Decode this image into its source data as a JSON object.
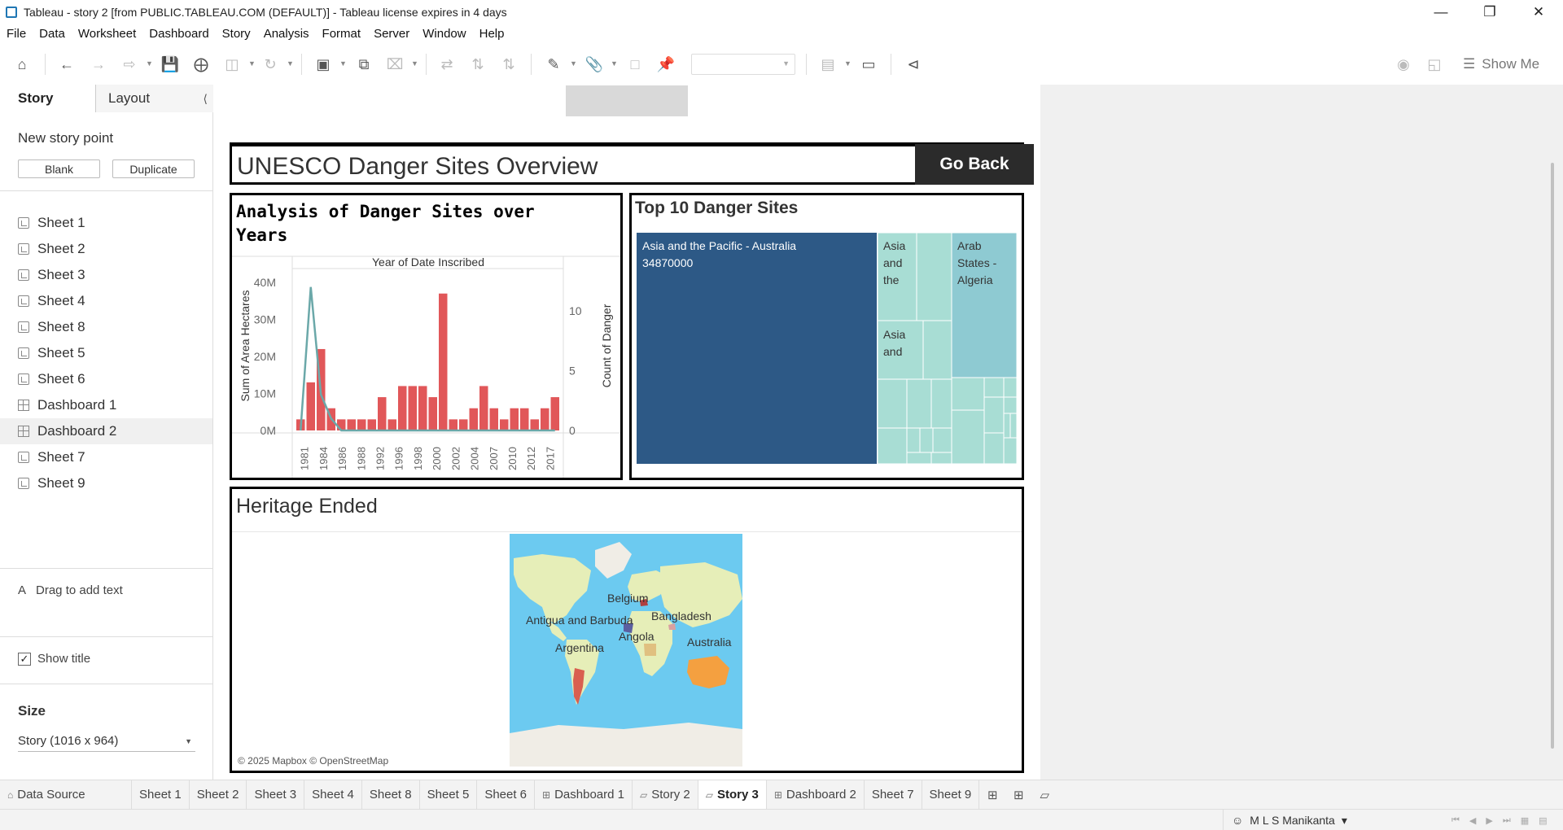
{
  "window": {
    "title": "Tableau - story 2 [from PUBLIC.TABLEAU.COM (DEFAULT)] - Tableau license expires in 4 days",
    "minimize_icon": "minimize-icon",
    "restore_icon": "restore-icon",
    "close_icon": "close-icon"
  },
  "menu": [
    "File",
    "Data",
    "Worksheet",
    "Dashboard",
    "Story",
    "Analysis",
    "Format",
    "Server",
    "Window",
    "Help"
  ],
  "toolbar": {
    "show_me": "Show Me"
  },
  "left_panel": {
    "tabs": {
      "story": "Story",
      "layout": "Layout"
    },
    "new_story_point": "New story point",
    "blank": "Blank",
    "duplicate": "Duplicate",
    "sheets": [
      {
        "label": "Sheet 1",
        "kind": "sheet"
      },
      {
        "label": "Sheet 2",
        "kind": "sheet"
      },
      {
        "label": "Sheet 3",
        "kind": "sheet"
      },
      {
        "label": "Sheet 4",
        "kind": "sheet"
      },
      {
        "label": "Sheet 8",
        "kind": "sheet"
      },
      {
        "label": "Sheet 5",
        "kind": "sheet"
      },
      {
        "label": "Sheet 6",
        "kind": "sheet"
      },
      {
        "label": "Dashboard 1",
        "kind": "dashboard"
      },
      {
        "label": "Dashboard 2",
        "kind": "dashboard",
        "active": true
      },
      {
        "label": "Sheet 7",
        "kind": "sheet"
      },
      {
        "label": "Sheet 9",
        "kind": "sheet"
      }
    ],
    "drag_to_add_text": "Drag to add text",
    "show_title": "Show title",
    "show_title_checked": true,
    "size_label": "Size",
    "size_value": "Story (1016 x 964)"
  },
  "story": {
    "title": "UNESCO Danger Sites Overview",
    "go_back": "Go Back",
    "colors": {
      "bar": "#e15759",
      "line": "#6ba8a9",
      "treemap_dark": "#2d5986",
      "treemap_mid": "#8ecad2",
      "treemap_light": "#a8ddd4",
      "ocean": "#6ccaf0"
    }
  },
  "analysis_chart": {
    "title": "Analysis of Danger Sites over Years",
    "header": "Year of Date Inscribed",
    "left_axis_label": "Sum of Area Hectares",
    "right_axis_label": "Count of Danger",
    "left_ticks": [
      "40M",
      "30M",
      "20M",
      "10M",
      "0M"
    ],
    "right_ticks": [
      "10",
      "5",
      "0"
    ],
    "x_ticks": [
      "1981",
      "1984",
      "1986",
      "1988",
      "1992",
      "1996",
      "1998",
      "2000",
      "2002",
      "2004",
      "2007",
      "2010",
      "2012",
      "2017"
    ]
  },
  "chart_data": {
    "type": "bar",
    "title": "Analysis of Danger Sites over Years",
    "xlabel": "Year of Date Inscribed",
    "ylabel": "Sum of Area Hectares",
    "y2label": "Count of Danger",
    "ylim": [
      0,
      42000000
    ],
    "y2lim": [
      0,
      13
    ],
    "series": [
      {
        "name": "Sum of Area Hectares",
        "type": "bar",
        "values": [
          3000000,
          13000000,
          22000000,
          6000000,
          3000000,
          3000000,
          3000000,
          3000000,
          9000000,
          3000000,
          12000000,
          12000000,
          12000000,
          9000000,
          37000000,
          3000000,
          3000000,
          6000000,
          12000000,
          6000000,
          3000000,
          6000000,
          6000000,
          3000000,
          6000000,
          9000000
        ]
      },
      {
        "name": "Count of Danger",
        "type": "line",
        "values": [
          0,
          12,
          3,
          1,
          0,
          0,
          0,
          0,
          0,
          0,
          0,
          0,
          0,
          0,
          0,
          0,
          0,
          0,
          0,
          0,
          0,
          0,
          0,
          0,
          0,
          0
        ]
      }
    ]
  },
  "top10": {
    "title": "Top 10 Danger Sites",
    "main_label": "Asia and the Pacific - Australia",
    "main_value": "34870000",
    "tile2": "Asia and the",
    "tile3": "Asia and",
    "tile4": "Arab States - Algeria"
  },
  "heritage": {
    "title": "Heritage Ended",
    "countries": [
      "Belgium",
      "Antigua and Barbuda",
      "Bangladesh",
      "Angola",
      "Argentina",
      "Australia"
    ],
    "copyright": "© 2025 Mapbox © OpenStreetMap"
  },
  "bottom_tabs": [
    {
      "label": "Data Source",
      "icon": "datasource-icon"
    },
    {
      "label": "Sheet 1"
    },
    {
      "label": "Sheet 2"
    },
    {
      "label": "Sheet 3"
    },
    {
      "label": "Sheet 4"
    },
    {
      "label": "Sheet 8"
    },
    {
      "label": "Sheet 5"
    },
    {
      "label": "Sheet 6"
    },
    {
      "label": "Dashboard 1",
      "icon": "dashboard-icon"
    },
    {
      "label": "Story 2",
      "icon": "story-icon"
    },
    {
      "label": "Story 3",
      "icon": "story-icon",
      "active": true
    },
    {
      "label": "Dashboard 2",
      "icon": "dashboard-icon"
    },
    {
      "label": "Sheet 7"
    },
    {
      "label": "Sheet 9"
    }
  ],
  "status": {
    "user": "M L S Manikanta"
  }
}
